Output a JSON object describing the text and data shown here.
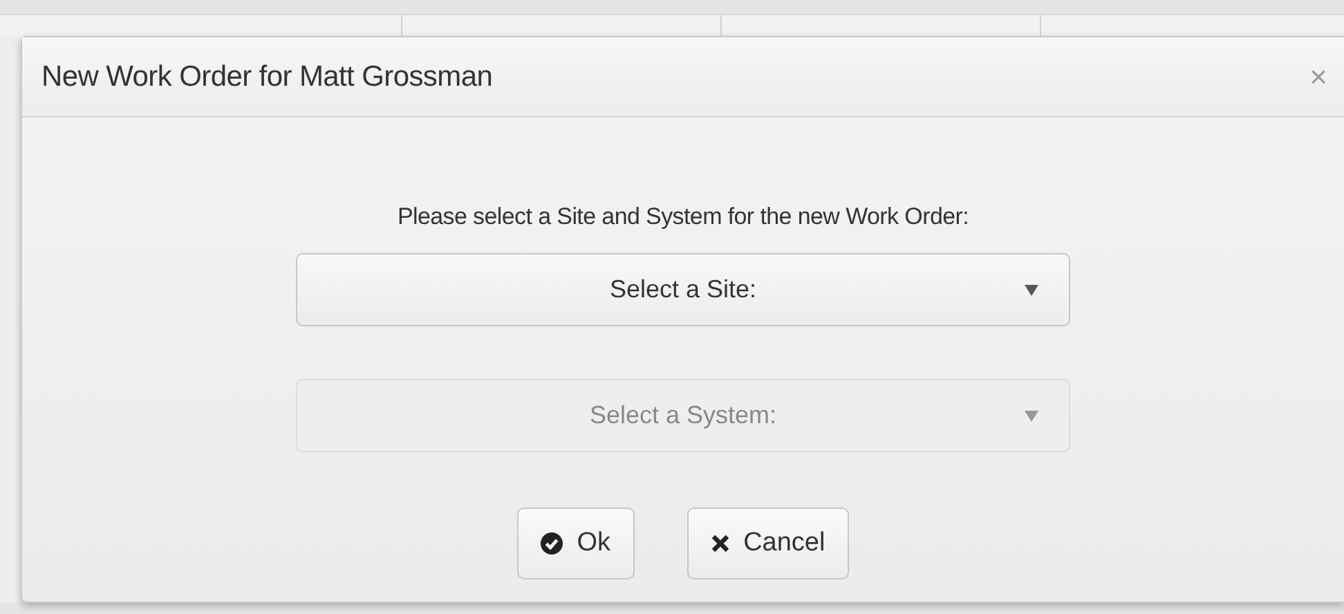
{
  "dialog": {
    "title": "New Work Order for Matt Grossman",
    "close": "×",
    "prompt": "Please select a Site and System for the new Work Order:",
    "selects": [
      {
        "placeholder": "Select a Site:",
        "disabled": false
      },
      {
        "placeholder": "Select a System:",
        "disabled": true
      }
    ],
    "buttons": [
      {
        "kind": "ok",
        "label": "Ok"
      },
      {
        "kind": "cancel",
        "label": "Cancel"
      }
    ]
  }
}
